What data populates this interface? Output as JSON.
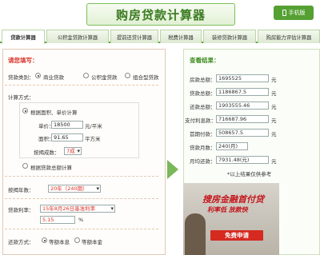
{
  "header": {
    "title": "购房贷款计算器",
    "mobile_label": "手机版"
  },
  "tabs": [
    "贷款计算器",
    "公积金贷款计算器",
    "提前还贷计算器",
    "税费计算器",
    "装修贷款计算器",
    "购房能力评估计算器"
  ],
  "form": {
    "section_title": "请您填写：",
    "loan_type_label": "贷款类别：",
    "loan_types": [
      "商业贷款",
      "公积金贷款",
      "组合型贷款"
    ],
    "calc_method_label": "计算方式：",
    "method_area": "根据面积、单价计算",
    "unit_price_label": "单价：",
    "unit_price_value": "18500",
    "unit_price_unit": "元/平米",
    "area_label": "面积：",
    "area_value": "91.65",
    "area_unit": "平方米",
    "ratio_label": "按揭成数：",
    "ratio_value": "7成",
    "method_total": "根据贷款总额计算",
    "years_label": "按揭年数：",
    "years_value": "20年（240期）",
    "rate_label": "贷款利率：",
    "rate_select": "15年8月26日基准利率",
    "rate_value": "5.15",
    "rate_unit": "%",
    "repay_label": "还款方式：",
    "repay_options": [
      "等额本息",
      "等额本金"
    ]
  },
  "result": {
    "section_title": "查看结果：",
    "rows": [
      {
        "label": "房款总额：",
        "value": "1695525",
        "unit": "元"
      },
      {
        "label": "贷款总额：",
        "value": "1186867.5",
        "unit": "元"
      },
      {
        "label": "还款总额：",
        "value": "1903555.46",
        "unit": "元"
      },
      {
        "label": "支付利息款：",
        "value": "716687.96",
        "unit": "元"
      },
      {
        "label": "首期付款：",
        "value": "508657.5",
        "unit": "元"
      },
      {
        "label": "贷款月数：",
        "value": "240(月)",
        "unit": ""
      },
      {
        "label": "月均还款：",
        "value": "7931.48(元)",
        "unit": "元"
      }
    ],
    "note": "*以上结果仅供参考"
  },
  "ad": {
    "headline": "搜房金融首付贷",
    "subline": "利率低 放款快",
    "button": "免费申请"
  }
}
